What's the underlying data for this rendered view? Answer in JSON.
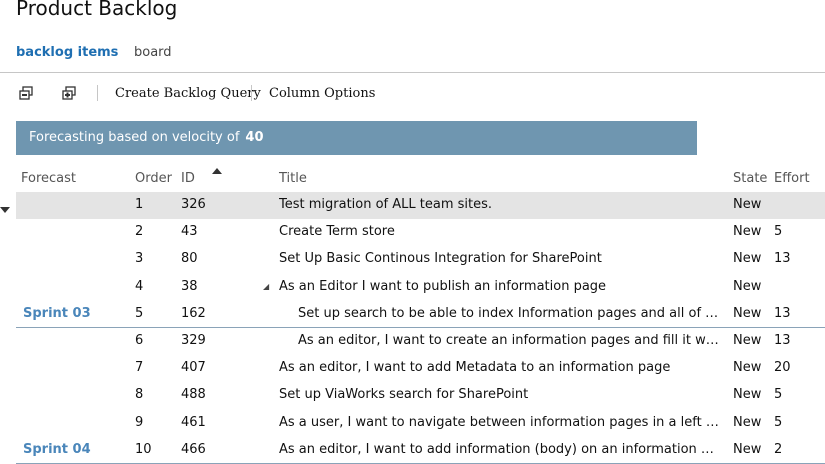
{
  "header": {
    "title": "Product Backlog"
  },
  "tabs": [
    {
      "label": "backlog items",
      "active": true
    },
    {
      "label": "board",
      "active": false
    }
  ],
  "toolbar": {
    "expand_icon": "expand-all-icon",
    "collapse_icon": "collapse-all-icon",
    "create_query_label": "Create Backlog Query",
    "column_options_label": "Column Options"
  },
  "forecast": {
    "label": "Forecasting based on velocity of",
    "velocity": "40"
  },
  "columns": {
    "forecast": "Forecast",
    "order": "Order",
    "id": "ID",
    "title": "Title",
    "state": "State",
    "effort": "Effort"
  },
  "rows": [
    {
      "order": "1",
      "id": "326",
      "title": "Test migration of ALL team sites.",
      "state": "New",
      "effort": "",
      "selected": true
    },
    {
      "order": "2",
      "id": "43",
      "title": "Create Term store",
      "state": "New",
      "effort": "5"
    },
    {
      "order": "3",
      "id": "80",
      "title": "Set Up Basic Continous Integration for SharePoint",
      "state": "New",
      "effort": "13"
    },
    {
      "order": "4",
      "id": "38",
      "title": "As an Editor I want to publish an information page",
      "state": "New",
      "effort": "",
      "expandable": true
    },
    {
      "order": "5",
      "id": "162",
      "title": "Set up search to be able to index Information pages and all of thei…",
      "state": "New",
      "effort": "13",
      "indent": 1
    },
    {
      "order": "6",
      "id": "329",
      "title": "As an editor, I want to create an information pages and fill it with …",
      "state": "New",
      "effort": "13",
      "indent": 1
    },
    {
      "order": "7",
      "id": "407",
      "title": "As an editor, I want to add Metadata to an information page",
      "state": "New",
      "effort": "20"
    },
    {
      "order": "8",
      "id": "488",
      "title": "Set up ViaWorks search for SharePoint",
      "state": "New",
      "effort": "5"
    },
    {
      "order": "9",
      "id": "461",
      "title": "As a user, I want to navigate between information pages in a left menu",
      "state": "New",
      "effort": "5"
    },
    {
      "order": "10",
      "id": "466",
      "title": "As an editor, I want to add information (body) on an information page",
      "state": "New",
      "effort": "2"
    }
  ],
  "sprints": [
    {
      "label": "Sprint 03",
      "last_row_index": 4
    },
    {
      "label": "Sprint 04",
      "last_row_index": 9
    }
  ],
  "colors": {
    "accent": "#1f6fb2",
    "banner": "#6f96b0",
    "sprint": "#4a86ba",
    "selected_row": "#e4e4e4"
  }
}
